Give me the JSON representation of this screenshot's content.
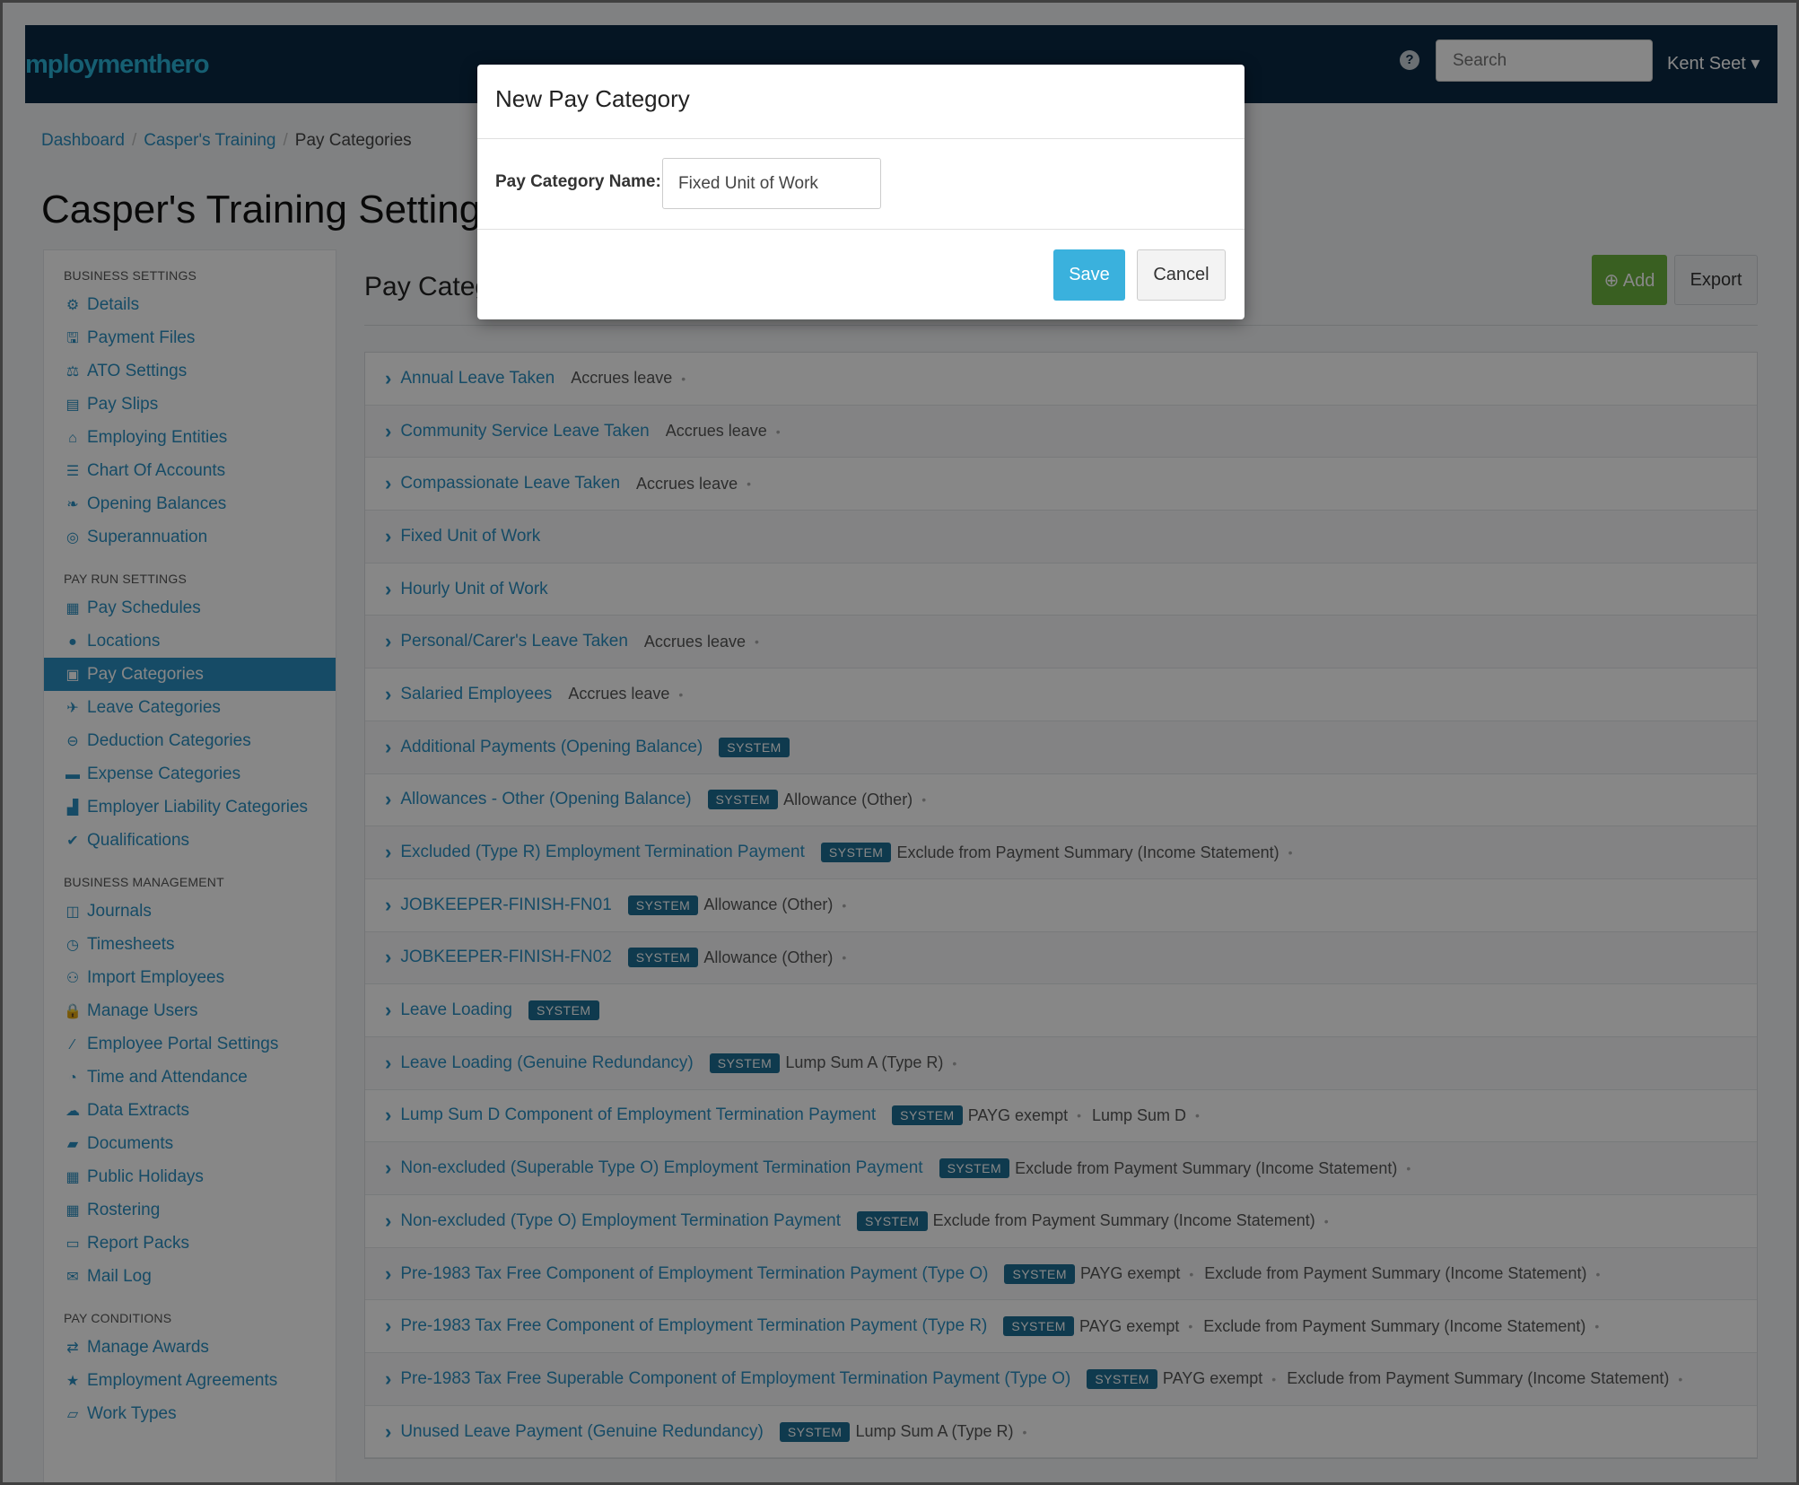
{
  "header": {
    "logo": "mploymenthero",
    "help_icon": "?",
    "search_placeholder": "Search",
    "user": "Kent Seet ▾"
  },
  "breadcrumb": [
    "Dashboard",
    "Casper's Training",
    "Pay Categories"
  ],
  "page_title": "Casper's Training Settings",
  "sidebar": {
    "sections": [
      {
        "heading": "BUSINESS SETTINGS",
        "items": [
          {
            "label": "Details",
            "icon": "gear-icon",
            "glyph": "⚙"
          },
          {
            "label": "Payment Files",
            "icon": "floppy-icon",
            "glyph": "🖫"
          },
          {
            "label": "ATO Settings",
            "icon": "scale-icon",
            "glyph": "⚖"
          },
          {
            "label": "Pay Slips",
            "icon": "file-icon",
            "glyph": "▤"
          },
          {
            "label": "Employing Entities",
            "icon": "bank-icon",
            "glyph": "⌂"
          },
          {
            "label": "Chart Of Accounts",
            "icon": "list-icon",
            "glyph": "☰"
          },
          {
            "label": "Opening Balances",
            "icon": "leaf-icon",
            "glyph": "❧"
          },
          {
            "label": "Superannuation",
            "icon": "lifebuoy-icon",
            "glyph": "◎"
          }
        ]
      },
      {
        "heading": "PAY RUN SETTINGS",
        "items": [
          {
            "label": "Pay Schedules",
            "icon": "calendar-icon",
            "glyph": "▦"
          },
          {
            "label": "Locations",
            "icon": "globe-icon",
            "glyph": "●"
          },
          {
            "label": "Pay Categories",
            "icon": "money-icon",
            "glyph": "▣",
            "active": true
          },
          {
            "label": "Leave Categories",
            "icon": "plane-icon",
            "glyph": "✈"
          },
          {
            "label": "Deduction Categories",
            "icon": "minus-circle-icon",
            "glyph": "⊖"
          },
          {
            "label": "Expense Categories",
            "icon": "archive-icon",
            "glyph": "▬"
          },
          {
            "label": "Employer Liability Categories",
            "icon": "chart-icon",
            "glyph": "▟"
          },
          {
            "label": "Qualifications",
            "icon": "check-icon",
            "glyph": "✔"
          }
        ]
      },
      {
        "heading": "BUSINESS MANAGEMENT",
        "items": [
          {
            "label": "Journals",
            "icon": "book-icon",
            "glyph": "◫"
          },
          {
            "label": "Timesheets",
            "icon": "clock-icon",
            "glyph": "◷"
          },
          {
            "label": "Import Employees",
            "icon": "users-icon",
            "glyph": "⚇"
          },
          {
            "label": "Manage Users",
            "icon": "lock-icon",
            "glyph": "🔒"
          },
          {
            "label": "Employee Portal Settings",
            "icon": "wand-icon",
            "glyph": "⁄"
          },
          {
            "label": "Time and Attendance",
            "icon": "stopwatch-icon",
            "glyph": "◔"
          },
          {
            "label": "Data Extracts",
            "icon": "cloud-download-icon",
            "glyph": "☁"
          },
          {
            "label": "Documents",
            "icon": "folder-icon",
            "glyph": "▰"
          },
          {
            "label": "Public Holidays",
            "icon": "calendar-icon",
            "glyph": "▦"
          },
          {
            "label": "Rostering",
            "icon": "calendar-icon",
            "glyph": "▦"
          },
          {
            "label": "Report Packs",
            "icon": "folder-open-icon",
            "glyph": "▭"
          },
          {
            "label": "Mail Log",
            "icon": "envelope-icon",
            "glyph": "✉"
          }
        ]
      },
      {
        "heading": "PAY CONDITIONS",
        "items": [
          {
            "label": "Manage Awards",
            "icon": "exchange-icon",
            "glyph": "⇄"
          },
          {
            "label": "Employment Agreements",
            "icon": "star-icon",
            "glyph": "★"
          },
          {
            "label": "Work Types",
            "icon": "book-icon",
            "glyph": "▱"
          }
        ]
      }
    ]
  },
  "panel": {
    "title": "Pay Categ",
    "add_label": "⊕ Add",
    "export_label": "Export"
  },
  "pay_categories": [
    {
      "name": "Annual Leave Taken",
      "tags": [
        "Accrues leave"
      ]
    },
    {
      "name": "Community Service Leave Taken",
      "tags": [
        "Accrues leave"
      ]
    },
    {
      "name": "Compassionate Leave Taken",
      "tags": [
        "Accrues leave"
      ]
    },
    {
      "name": "Fixed Unit of Work",
      "tags": []
    },
    {
      "name": "Hourly Unit of Work",
      "tags": []
    },
    {
      "name": "Personal/Carer's Leave Taken",
      "tags": [
        "Accrues leave"
      ]
    },
    {
      "name": "Salaried Employees",
      "tags": [
        "Accrues leave"
      ]
    },
    {
      "name": "Additional Payments (Opening Balance)",
      "badge": "SYSTEM",
      "tags": []
    },
    {
      "name": "Allowances - Other (Opening Balance)",
      "badge": "SYSTEM",
      "tags": [
        "Allowance (Other)"
      ]
    },
    {
      "name": "Excluded (Type R) Employment Termination Payment",
      "badge": "SYSTEM",
      "tags": [
        "Exclude from Payment Summary (Income Statement)"
      ]
    },
    {
      "name": "JOBKEEPER-FINISH-FN01",
      "badge": "SYSTEM",
      "tags": [
        "Allowance (Other)"
      ]
    },
    {
      "name": "JOBKEEPER-FINISH-FN02",
      "badge": "SYSTEM",
      "tags": [
        "Allowance (Other)"
      ]
    },
    {
      "name": "Leave Loading",
      "badge": "SYSTEM",
      "tags": []
    },
    {
      "name": "Leave Loading (Genuine Redundancy)",
      "badge": "SYSTEM",
      "tags": [
        "Lump Sum A (Type R)"
      ]
    },
    {
      "name": "Lump Sum D Component of Employment Termination Payment",
      "badge": "SYSTEM",
      "tags": [
        "PAYG exempt",
        "Lump Sum D"
      ]
    },
    {
      "name": "Non-excluded (Superable Type O) Employment Termination Payment",
      "badge": "SYSTEM",
      "tags": [
        "Exclude from Payment Summary (Income Statement)"
      ]
    },
    {
      "name": "Non-excluded (Type O) Employment Termination Payment",
      "badge": "SYSTEM",
      "tags": [
        "Exclude from Payment Summary (Income Statement)"
      ]
    },
    {
      "name": "Pre-1983 Tax Free Component of Employment Termination Payment (Type O)",
      "badge": "SYSTEM",
      "tags": [
        "PAYG exempt",
        "Exclude from Payment Summary (Income Statement)"
      ]
    },
    {
      "name": "Pre-1983 Tax Free Component of Employment Termination Payment (Type R)",
      "badge": "SYSTEM",
      "tags": [
        "PAYG exempt",
        "Exclude from Payment Summary (Income Statement)"
      ]
    },
    {
      "name": "Pre-1983 Tax Free Superable Component of Employment Termination Payment (Type O)",
      "badge": "SYSTEM",
      "tags": [
        "PAYG exempt",
        "Exclude from Payment Summary (Income Statement)"
      ]
    },
    {
      "name": "Unused Leave Payment (Genuine Redundancy)",
      "badge": "SYSTEM",
      "tags": [
        "Lump Sum A (Type R)"
      ]
    }
  ],
  "modal": {
    "title": "New Pay Category",
    "field_label": "Pay Category Name:",
    "field_value": "Fixed Unit of Work",
    "save_label": "Save",
    "cancel_label": "Cancel"
  },
  "colors": {
    "brand_navy": "#0a2842",
    "link_blue": "#2a8fc1",
    "add_green": "#6cb33f",
    "save_blue": "#3ab1dd",
    "system_badge": "#1d6e93"
  }
}
